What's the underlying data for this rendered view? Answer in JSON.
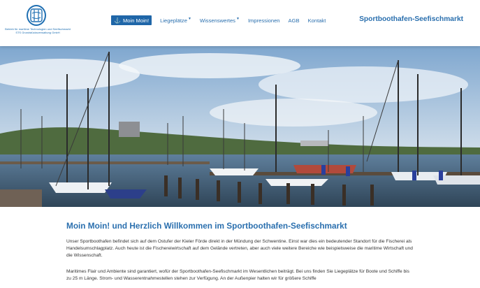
{
  "logo": {
    "line1": "Betrieb für maritime Technologien und Seefischmarkt",
    "line2": "STS Grundstücksverwaltung GmbH"
  },
  "nav": {
    "items": [
      {
        "label": "Moin Moin!",
        "icon": "anchor-icon",
        "active": true
      },
      {
        "label": "Liegeplätze",
        "dropdown": true
      },
      {
        "label": "Wissenswertes",
        "dropdown": true
      },
      {
        "label": "Impressionen"
      },
      {
        "label": "AGB"
      },
      {
        "label": "Kontakt"
      }
    ],
    "brand": "Sportboothafen-Seefischmarkt"
  },
  "hero": {
    "alt_visible": "",
    "description": "harbour with sailing boats"
  },
  "content": {
    "headline": "Moin Moin! und Herzlich Willkommen im Sportboothafen-Seefischmarkt",
    "paragraphs": [
      "Unser Sportboothafen befindet sich auf dem Ostufer der Kieler Förde direkt in der Mündung der Schwentine. Einst war dies ein bedeutender Standort für die Fischerei als Handelsumschlagplatz. Auch heute ist die Fischereiwirtschaft auf dem Gelände vertreten, aber auch viele weitere Bereiche wie beispielsweise die maritime Wirtschaft und die Wissenschaft.",
      "Maritimes Flair und Ambiente sind garantiert, wofür der Sportboothafen-Seefischmarkt im Wesentlichen beiträgt. Bei uns finden Sie Liegeplätze für Boote und Schiffe bis zu 25 m Länge. Strom- und Wasserentnahmestellen stehen zur Verfügung. An der Außenpier halten wir für größere Schiffe"
    ]
  },
  "colors": {
    "accent": "#2a6fae",
    "active_nav_bg": "#1f66a8"
  }
}
